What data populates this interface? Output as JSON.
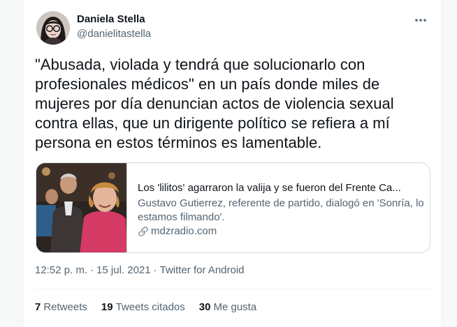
{
  "user": {
    "display_name": "Daniela Stella",
    "handle": "@danielitastella",
    "avatar_icon": "avatar-photo"
  },
  "tweet": {
    "text": "\"Abusada, violada y tendrá que solucionarlo con profesionales médicos\" en un país donde miles de mujeres por día denuncian actos de violencia sexual contra ellas, que un dirigente político se refiera a mí persona en estos términos es lamentable."
  },
  "link_card": {
    "title": "Los 'lilitos' agarraron la valija y se fueron del Frente Ca...",
    "description": "Gustavo Gutierrez, referente de partido, dialogó en 'Sonría, lo estamos filmando'.",
    "domain": "mdzradio.com",
    "domain_icon": "link-icon"
  },
  "meta": {
    "time": "12:52 p. m.",
    "separator": "·",
    "date": "15 jul. 2021",
    "source": "Twitter for Android"
  },
  "stats": {
    "retweets_count": "7",
    "retweets_label": "Retweets",
    "quotes_count": "19",
    "quotes_label": "Tweets citados",
    "likes_count": "30",
    "likes_label": "Me gusta"
  },
  "colors": {
    "text_primary": "#0f1419",
    "text_secondary": "#536471",
    "border": "#cfd9de"
  }
}
